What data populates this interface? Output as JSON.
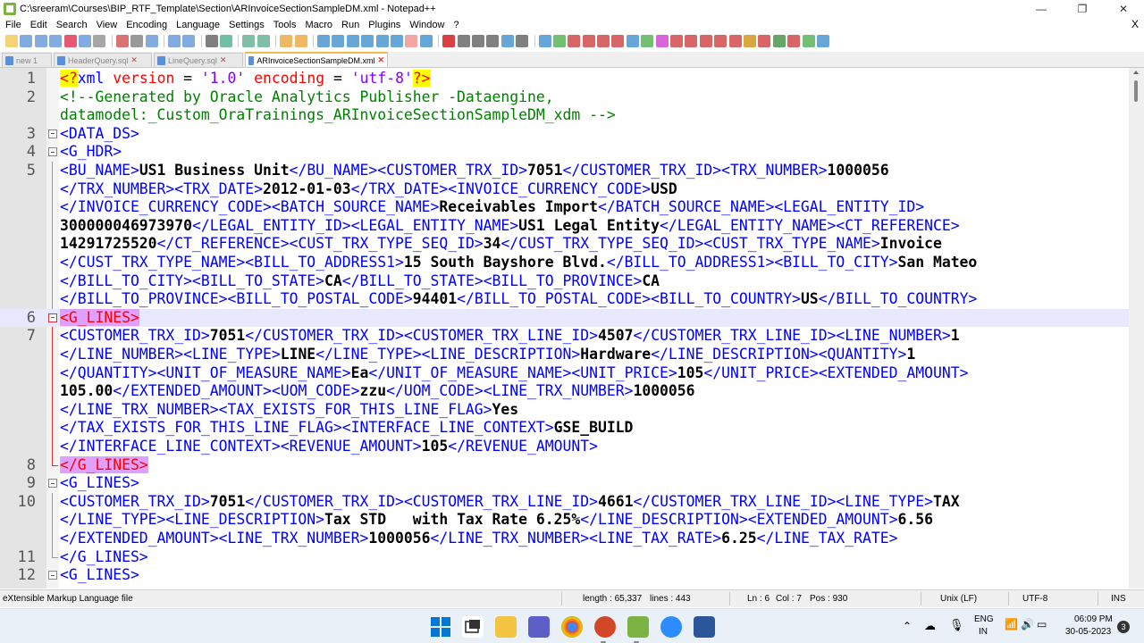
{
  "window": {
    "title": "C:\\sreeram\\Courses\\BIP_RTF_Template\\Section\\ARInvoiceSectionSampleDM.xml - Notepad++",
    "min": "—",
    "max": "❐",
    "close": "✕"
  },
  "menu": [
    "File",
    "Edit",
    "Search",
    "View",
    "Encoding",
    "Language",
    "Settings",
    "Tools",
    "Macro",
    "Run",
    "Plugins",
    "Window",
    "?"
  ],
  "menu_close": "X",
  "tabs": [
    {
      "label": "new 1"
    },
    {
      "label": "HeaderQuery.sql"
    },
    {
      "label": "LineQuery.sql"
    },
    {
      "label": "ARInvoiceSectionSampleDM.xml",
      "active": true
    }
  ],
  "editor": {
    "line_numbers": [
      "1",
      "2",
      "",
      "3",
      "4",
      "5",
      "",
      "",
      "",
      "",
      "",
      "",
      "",
      "6",
      "7",
      "",
      "",
      "",
      "",
      "",
      "",
      "8",
      "9",
      "10",
      "",
      "",
      "11",
      "12"
    ],
    "lines": [
      "1.0",
      "utf-8",
      "<!--Generated by Oracle Analytics Publisher -Dataengine,",
      "datamodel:_Custom_OraTrainings_ARInvoiceSectionSampleDM_xdm -->"
    ]
  },
  "status": {
    "file_type": "eXtensible Markup Language file",
    "length": "length : 65,337",
    "lines": "lines : 443",
    "ln": "Ln : 6",
    "col": "Col : 7",
    "pos": "Pos : 930",
    "eol": "Unix (LF)",
    "encoding": "UTF-8",
    "mode": "INS"
  },
  "taskbar": {
    "lang1": "ENG",
    "lang2": "IN",
    "time": "06:09 PM",
    "date": "30-05-2023",
    "notif": "3"
  }
}
